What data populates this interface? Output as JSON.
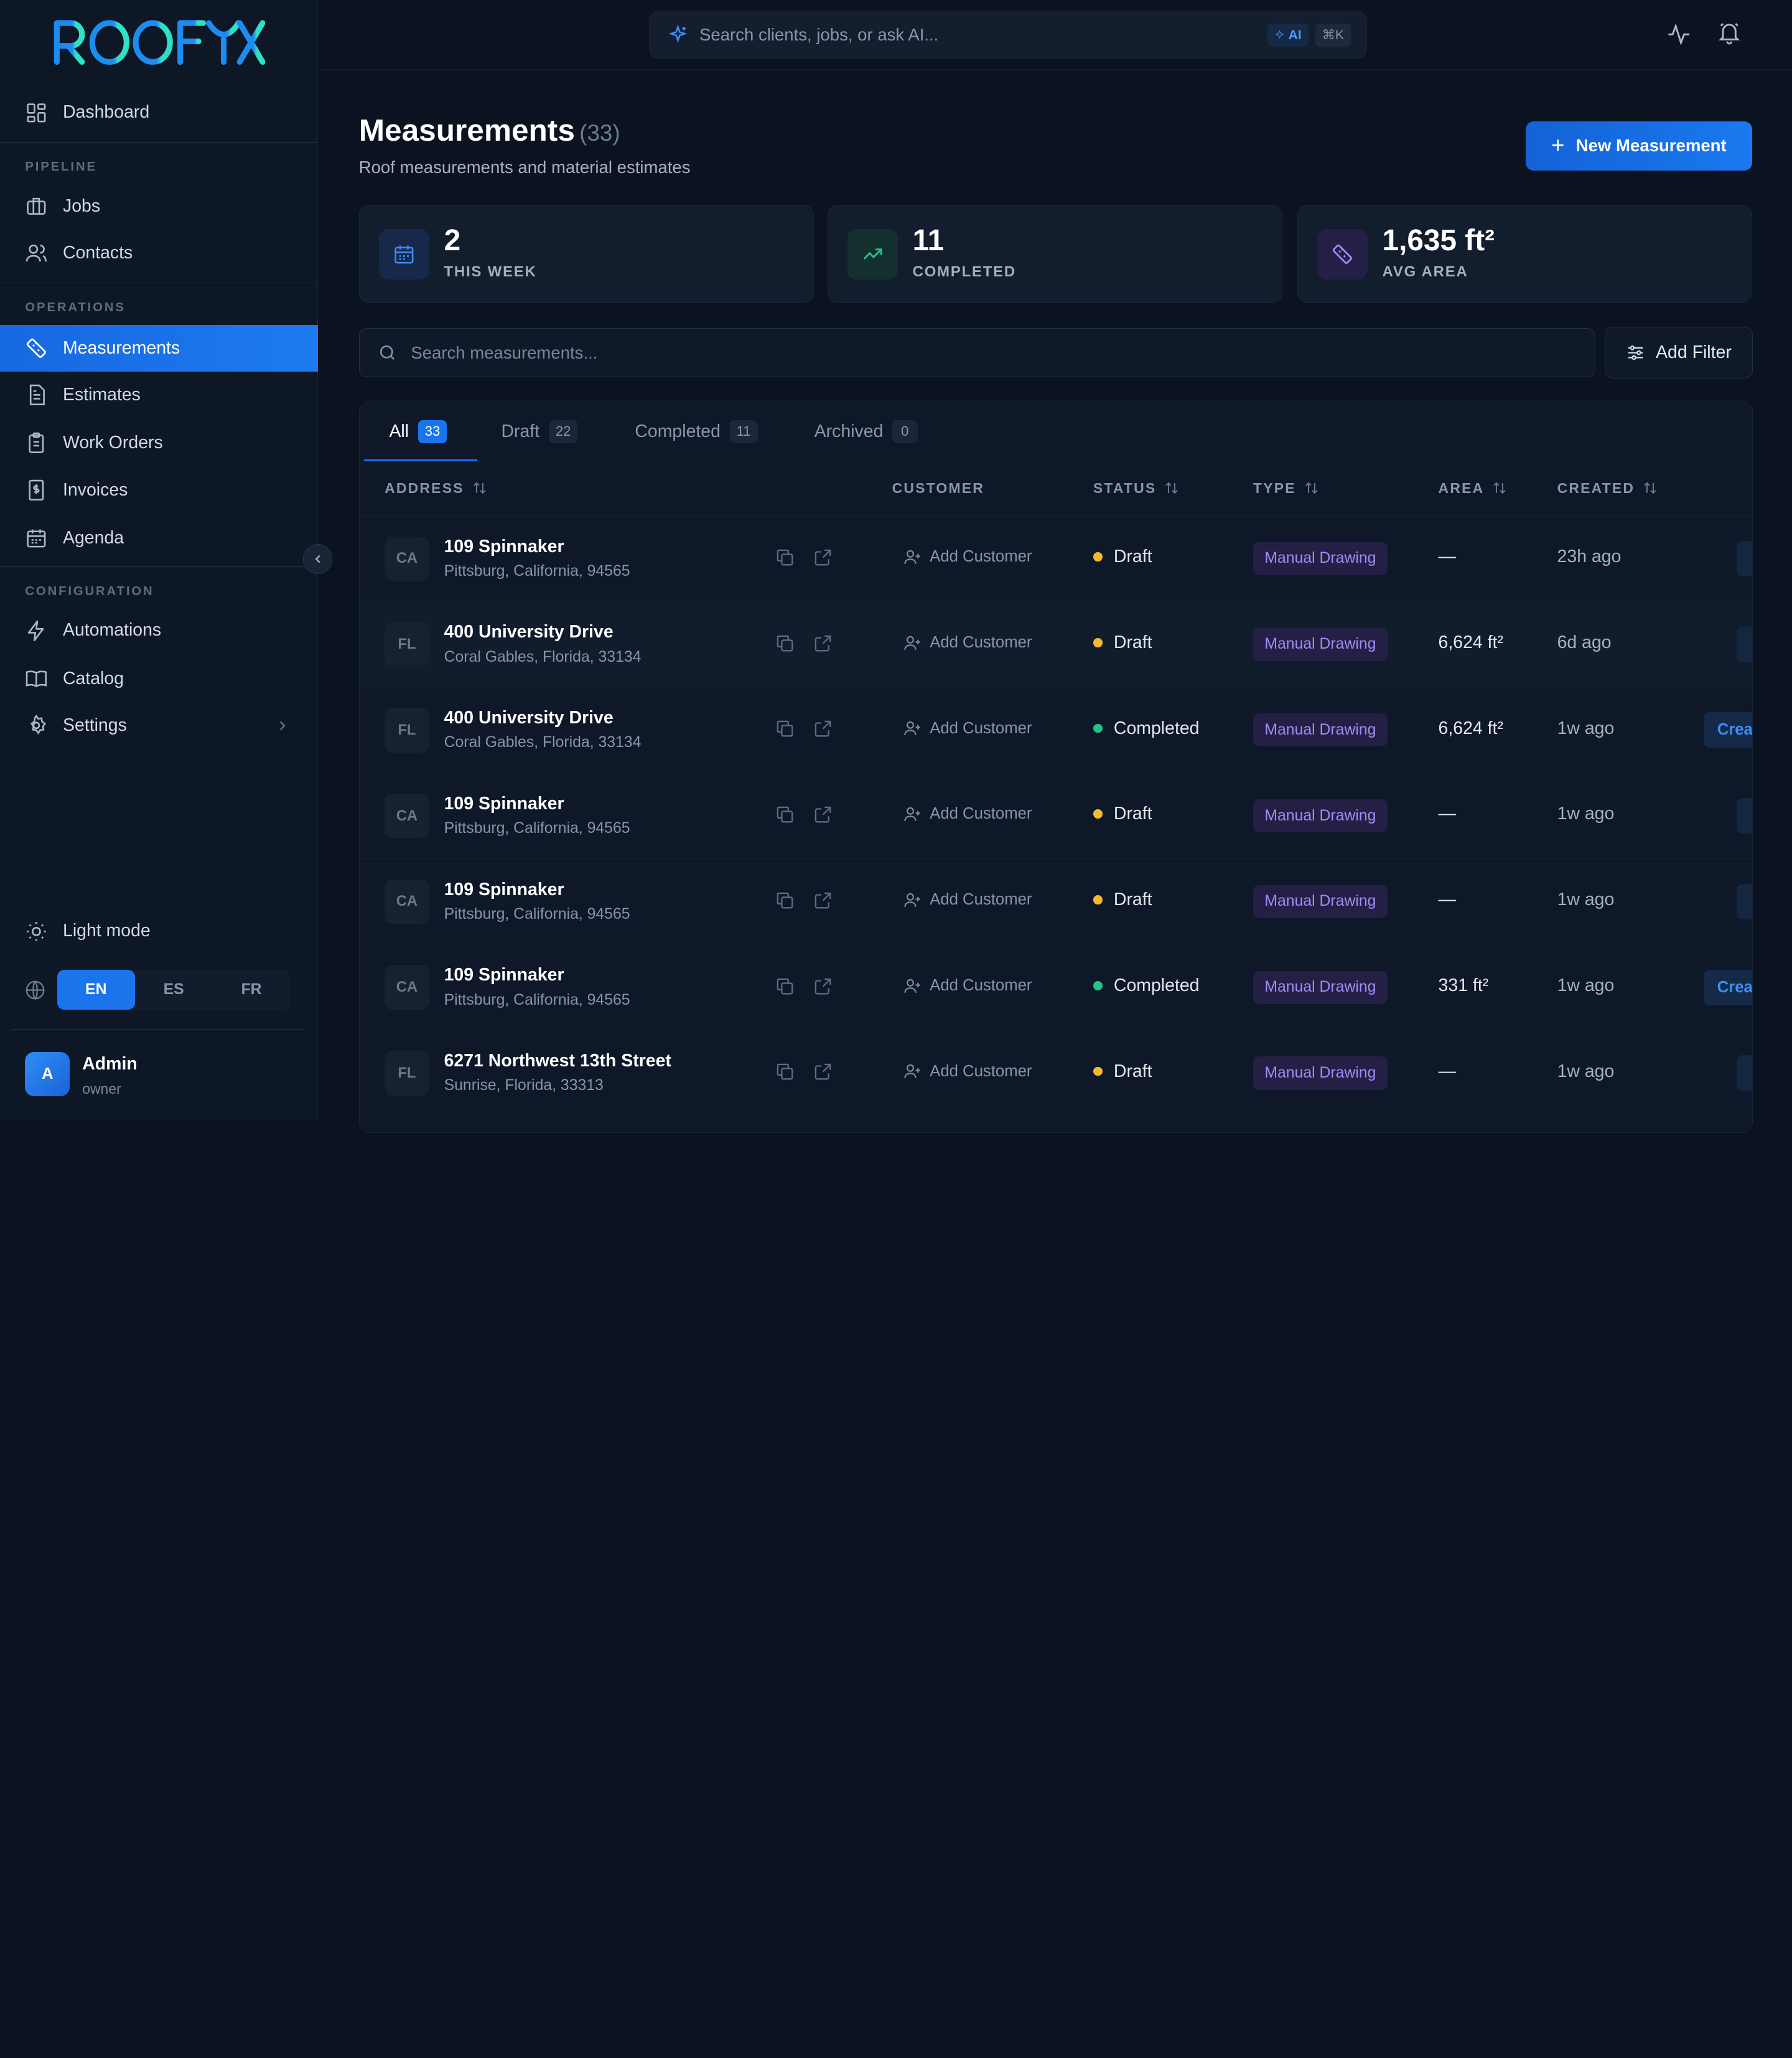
{
  "brand": {
    "name": "ROOFYX",
    "colors": {
      "logo_blue": "#1d8cf0",
      "logo_teal": "#2fe0c6",
      "accent": "#1a75ec"
    }
  },
  "sidebar": {
    "dashboard": "Dashboard",
    "pipeline_label": "PIPELINE",
    "jobs": "Jobs",
    "contacts": "Contacts",
    "operations_label": "OPERATIONS",
    "measurements": "Measurements",
    "estimates": "Estimates",
    "work_orders": "Work Orders",
    "invoices": "Invoices",
    "agenda": "Agenda",
    "configuration_label": "CONFIGURATION",
    "automations": "Automations",
    "catalog": "Catalog",
    "settings": "Settings",
    "light_mode": "Light mode",
    "languages": [
      "EN",
      "ES",
      "FR"
    ],
    "active_language": "EN",
    "user": {
      "initial": "A",
      "name": "Admin",
      "role": "owner"
    }
  },
  "topbar": {
    "search_placeholder": "Search clients, jobs, or ask AI...",
    "ai_badge": "AI",
    "shortcut": "⌘K"
  },
  "page": {
    "title": "Measurements",
    "count": "(33)",
    "subtitle": "Roof measurements and material estimates",
    "new_button": "New Measurement"
  },
  "stats": [
    {
      "value": "2",
      "label": "THIS WEEK",
      "icon": "calendar-icon"
    },
    {
      "value": "11",
      "label": "COMPLETED",
      "icon": "trending-up-icon"
    },
    {
      "value": "1,635 ft²",
      "label": "AVG AREA",
      "icon": "ruler-icon"
    }
  ],
  "filters": {
    "search_placeholder": "Search measurements...",
    "add_filter": "Add Filter"
  },
  "tabs": [
    {
      "label": "All",
      "count": "33"
    },
    {
      "label": "Draft",
      "count": "22"
    },
    {
      "label": "Completed",
      "count": "11"
    },
    {
      "label": "Archived",
      "count": "0"
    }
  ],
  "table": {
    "headers": {
      "address": "ADDRESS",
      "customer": "CUSTOMER",
      "status": "STATUS",
      "type": "TYPE",
      "area": "AREA",
      "created": "CREATED"
    },
    "add_customer_label": "Add Customer",
    "create_label": "Create",
    "rows": [
      {
        "state": "CA",
        "address": "109 Spinnaker",
        "city": "Pittsburg, California, 94565",
        "status": "Draft",
        "type": "Manual Drawing",
        "area": "—",
        "created": "23h ago"
      },
      {
        "state": "FL",
        "address": "400 University Drive",
        "city": "Coral Gables, Florida, 33134",
        "status": "Draft",
        "type": "Manual Drawing",
        "area": "6,624 ft²",
        "created": "6d ago"
      },
      {
        "state": "FL",
        "address": "400 University Drive",
        "city": "Coral Gables, Florida, 33134",
        "status": "Completed",
        "type": "Manual Drawing",
        "area": "6,624 ft²",
        "created": "1w ago"
      },
      {
        "state": "CA",
        "address": "109 Spinnaker",
        "city": "Pittsburg, California, 94565",
        "status": "Draft",
        "type": "Manual Drawing",
        "area": "—",
        "created": "1w ago"
      },
      {
        "state": "CA",
        "address": "109 Spinnaker",
        "city": "Pittsburg, California, 94565",
        "status": "Draft",
        "type": "Manual Drawing",
        "area": "—",
        "created": "1w ago"
      },
      {
        "state": "CA",
        "address": "109 Spinnaker",
        "city": "Pittsburg, California, 94565",
        "status": "Completed",
        "type": "Manual Drawing",
        "area": "331 ft²",
        "created": "1w ago"
      },
      {
        "state": "FL",
        "address": "6271 Northwest 13th Street",
        "city": "Sunrise, Florida, 33313",
        "status": "Draft",
        "type": "Manual Drawing",
        "area": "—",
        "created": "1w ago"
      }
    ],
    "status_colors": {
      "Draft": "#f5b82e",
      "Completed": "#22c487"
    }
  }
}
